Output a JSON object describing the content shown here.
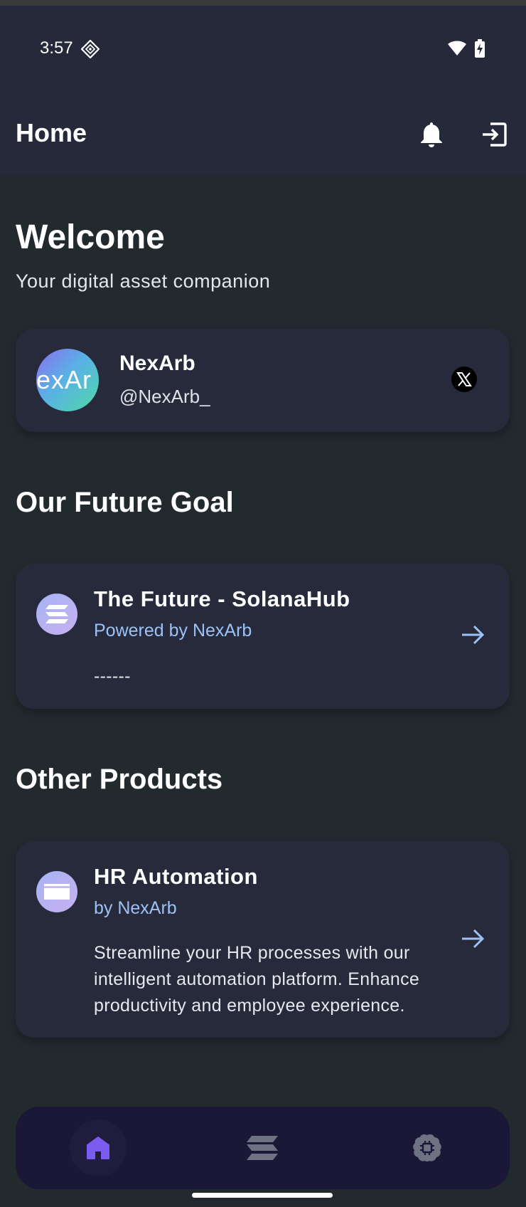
{
  "status_bar": {
    "time": "3:57",
    "icons": [
      "diamond-notification-icon",
      "wifi-icon",
      "battery-charging-icon"
    ]
  },
  "app_bar": {
    "title": "Home",
    "actions": [
      "bell-icon",
      "logout-icon"
    ]
  },
  "welcome": {
    "title": "Welcome",
    "subtitle": "Your digital asset companion"
  },
  "profile": {
    "avatar_text": "exAr",
    "name": "NexArb",
    "handle": "@NexArb_",
    "social_icon": "x-logo-icon"
  },
  "future_goal": {
    "section_title": "Our Future Goal",
    "product": {
      "name": "The Future - SolanaHub",
      "by": "Powered by NexArb",
      "description": "------",
      "icon": "solana-icon"
    }
  },
  "other_products": {
    "section_title": "Other Products",
    "items": [
      {
        "name": "HR Automation",
        "by": "by NexArb",
        "description": "Streamline your HR processes with our intelligent automation platform. Enhance productivity and employee experience.",
        "icon": "card-icon"
      }
    ]
  },
  "bottom_nav": {
    "items": [
      {
        "icon": "home-icon",
        "active": true
      },
      {
        "icon": "solana-icon",
        "active": false
      },
      {
        "icon": "brain-icon",
        "active": false
      }
    ]
  },
  "colors": {
    "background": "#222a2e",
    "app_bar": "#252939",
    "card": "#262a3b",
    "link": "#9cc2f5",
    "nav_bg": "#1a1836",
    "nav_active": "#7b5cf0",
    "nav_inactive": "#6e7283"
  }
}
